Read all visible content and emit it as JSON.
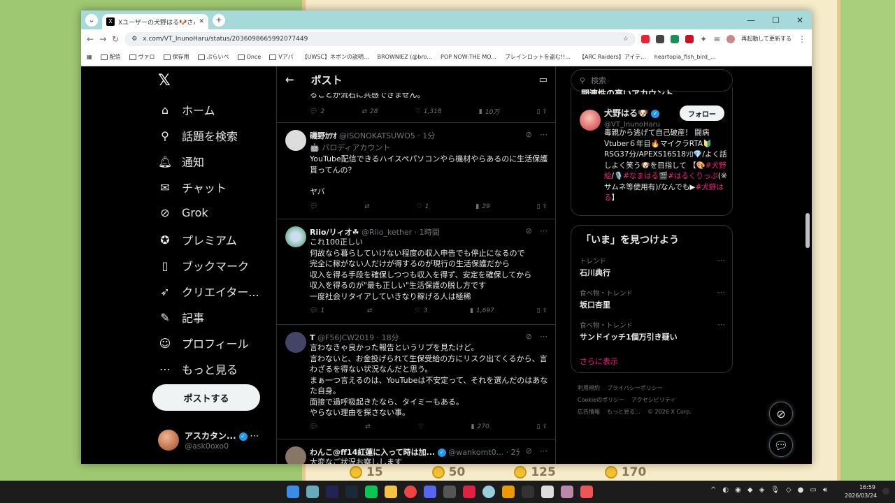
{
  "browser": {
    "tab_title": "Xユーザーの犬野はる🐶さん:「お米",
    "url": "x.com/VT_InunoHaru/status/2036098665992077449",
    "restart_label": "再起動して更新する",
    "bookmarks": [
      "配信",
      "ヴァロ",
      "保存用",
      "ぷらいべ",
      "Once",
      "Vアパ",
      "【UWSC】ネボンの説明...",
      "BROWNIEZ (@bro...",
      "POP NOW:THE MO...",
      "ブレインロットを盗む!!...",
      "【ARC Raiders】アイテ...",
      "heartopia_fish_bird_..."
    ]
  },
  "nav": {
    "items": [
      "ホーム",
      "話題を検索",
      "通知",
      "チャット",
      "Grok",
      "プレミアム",
      "ブックマーク",
      "クリエイター...",
      "記事",
      "プロフィール",
      "もっと見る"
    ],
    "post_button": "ポストする",
    "me_name": "アスカタン...",
    "me_handle": "@ask0oxo0"
  },
  "main": {
    "title": "ポスト",
    "partial_text": "ることが流石に共感できません。",
    "partial_actions": [
      "2",
      "28",
      "1,318",
      "10万"
    ],
    "tweets": [
      {
        "name": "磯野ｶﾂｵ",
        "handle": "@ISONOKATSUWO5",
        "time": "1分",
        "sub": "🤖 パロディアカウント",
        "text": "YouTube配信できるハイスペパソコンやら機材やらあるのに生活保護貰ってんの？\n\nヤバ",
        "actions": [
          "",
          "",
          "1",
          "29"
        ]
      },
      {
        "name": "Riio/リィオ☘",
        "handle": "@Riio_kether",
        "time": "1時間",
        "sub": "",
        "text": "これ100正しい\n何故なら暮らしていけない程度の収入申告でも停止になるので\n完全に稼がない人だけが得するのが現行の生活保護だから\n収入を得る手段を確保しつつも収入を得ず、安定を確保してから\n収入を得るのが\"最も正しい\"生活保護の脱し方です\n一度社会リタイアしていきなり稼げる人は極稀",
        "actions": [
          "1",
          "",
          "3",
          "1,697"
        ]
      },
      {
        "name": "T",
        "handle": "@F56JCW2019",
        "time": "18分",
        "sub": "",
        "text": "言わなきゃ良かった報告というリプを見たけど。\n言わないと、お金投げられて生保受給の方にリスク出てくるから、言わざるを得ない状況なんだと思う。\nまぁ一つ言えるのは、YouTubeは不安定って、それを選んだのはあなた自身。\n面接で過呼吸起きたなら、タイミーもある。\nやらない理由を探さない事。",
        "actions": [
          "",
          "",
          "",
          "270"
        ]
      },
      {
        "name": "わんこ@ff14紅蓮に入って時は加...",
        "handle": "@wankomt0...",
        "time": "2分",
        "sub": "",
        "text": "大変なご状況お察しします",
        "actions": [
          "",
          "",
          "",
          ""
        ]
      }
    ]
  },
  "right": {
    "search_placeholder": "検索",
    "related_title": "関連性の高いアカウント",
    "account_name": "犬野はる🐶",
    "account_handle": "@VT_InunoHaru",
    "follow_label": "フォロー",
    "bio_1": "毒親から逃げて自己破産！ 闘病Vtuber６年目🔥マイクラRTA🔰RSG37分/APEXS16S18ｿﾛ💎/よく話しよく笑う🐶を目指して 【🎨",
    "bio_tag1": "#犬野絵",
    "bio_2": "/🎙️",
    "bio_tag2": "#なまはる",
    "bio_3": "🎬",
    "bio_tag3": "#はるくりっぷ",
    "bio_4": "(※サムネ等使用有)/なんでも▶",
    "bio_tag4": "#犬野はる",
    "bio_5": "】",
    "trends_title": "「いま」を見つけよう",
    "trends": [
      {
        "cat": "トレンド",
        "name": "石川典行"
      },
      {
        "cat": "食べ物・トレンド",
        "name": "坂口杏里"
      },
      {
        "cat": "食べ物・トレンド",
        "name": "サンドイッチ1個万引き疑い"
      }
    ],
    "show_more": "さらに表示",
    "footer": [
      "利用規約",
      "プライバシーポリシー",
      "Cookieのポリシー",
      "アクセシビリティ",
      "広告情報",
      "もっと見る…",
      "© 2026 X Corp."
    ]
  },
  "game": {
    "coins": [
      "15",
      "50",
      "125",
      "170"
    ]
  },
  "taskbar": {
    "time": "16:59",
    "date": "2026/03/24"
  }
}
